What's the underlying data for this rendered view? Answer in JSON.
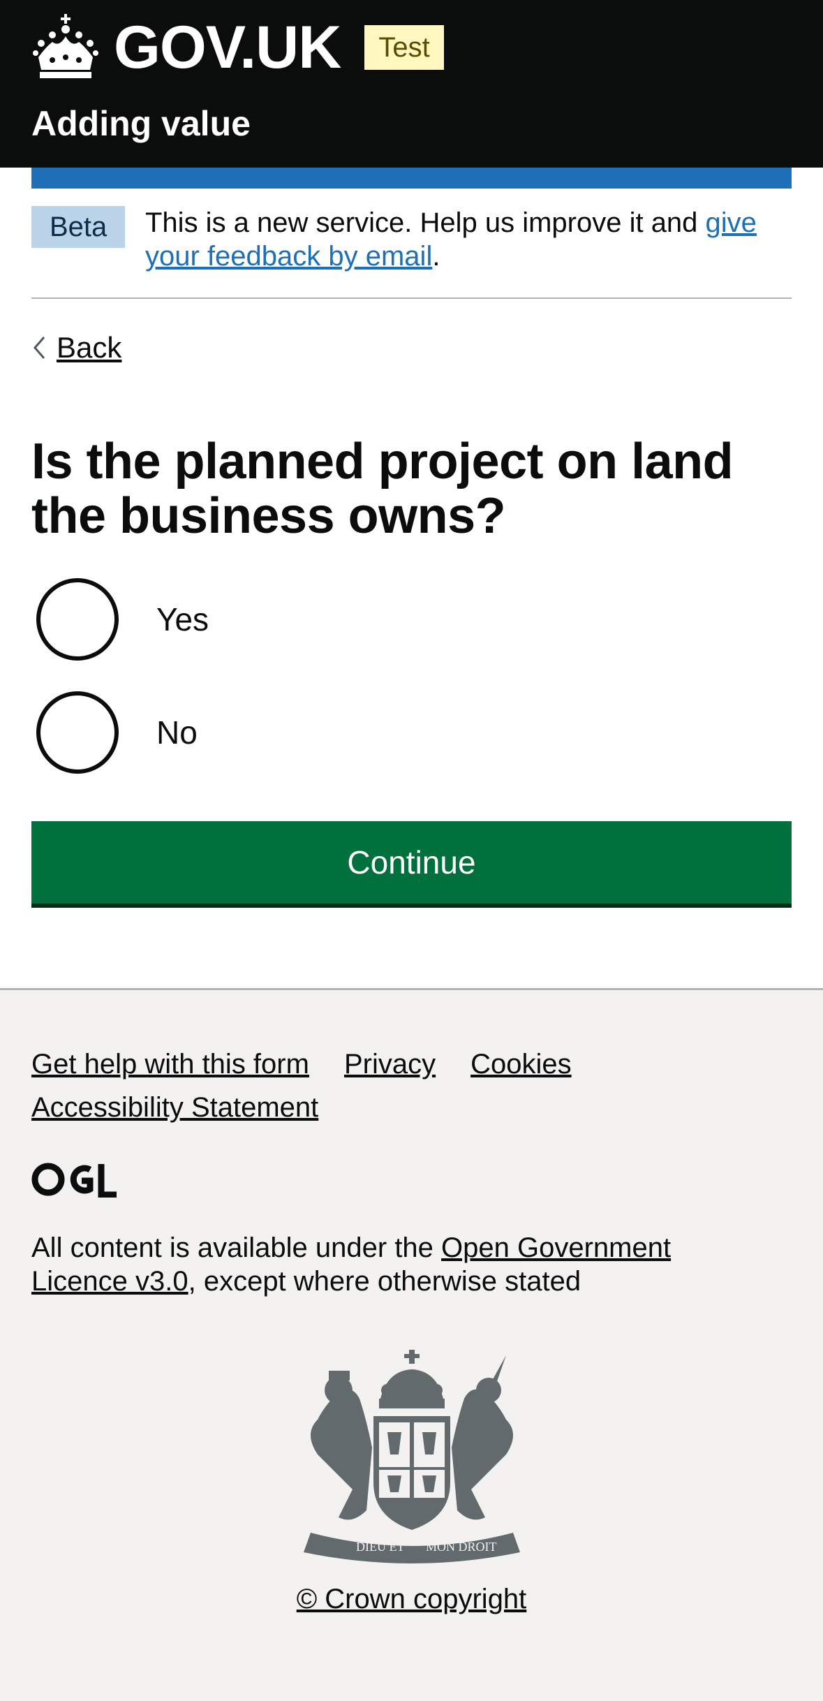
{
  "header": {
    "brand": "GOV.UK",
    "environment_tag": "Test",
    "service_name": "Adding value"
  },
  "phase_banner": {
    "tag": "Beta",
    "text_before": "This is a new service. Help us improve it and ",
    "link_text": "give your feedback by email",
    "text_after": "."
  },
  "back_link": "Back",
  "question": "Is the planned project on land the business owns?",
  "options": [
    {
      "label": "Yes",
      "selected": false
    },
    {
      "label": "No",
      "selected": false
    }
  ],
  "continue_label": "Continue",
  "footer": {
    "links": [
      "Get help with this form",
      "Privacy",
      "Cookies",
      "Accessibility Statement"
    ],
    "licence_before": "All content is available under the ",
    "licence_link": "Open Government Licence v3.0",
    "licence_after": ", except where otherwise stated",
    "copyright": "© Crown copyright",
    "ogl_logo_text": "OGL",
    "crest_motto": [
      "DIEU ET",
      "MON DROIT"
    ]
  },
  "colors": {
    "header_bg": "#0b0c0c",
    "brand_blue": "#1d70b8",
    "button_green": "#00703c",
    "footer_bg": "#f3f2f1",
    "test_tag_bg": "#fff7bf",
    "beta_tag_bg": "#bbd4ea"
  }
}
